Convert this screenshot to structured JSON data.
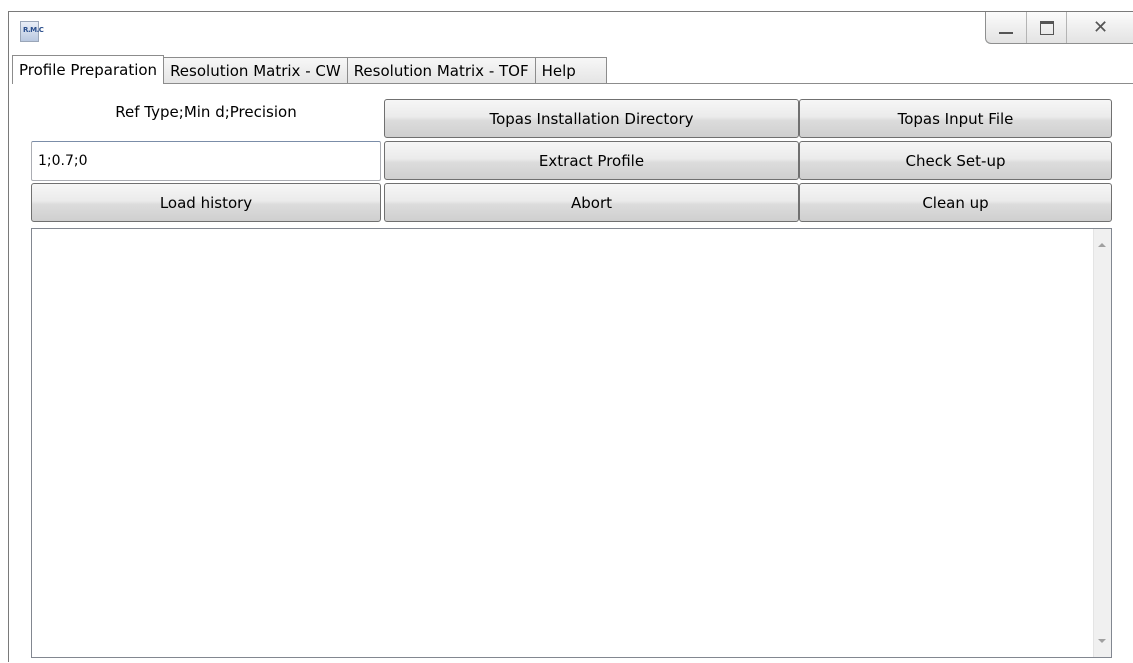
{
  "window": {
    "app_icon_text": "R.M.C",
    "controls": {
      "minimize": "minimize",
      "maximize": "maximize",
      "close": "close"
    }
  },
  "tabs": [
    {
      "label": "Profile Preparation",
      "active": true
    },
    {
      "label": "Resolution Matrix - CW",
      "active": false
    },
    {
      "label": "Resolution Matrix - TOF",
      "active": false
    },
    {
      "label": "Help",
      "active": false
    }
  ],
  "form": {
    "ref_label": "Ref Type;Min d;Precision",
    "ref_value": "1;0.7;0",
    "topas_dir_button": "Topas Installation Directory",
    "topas_input_button": "Topas Input File",
    "extract_button": "Extract Profile",
    "check_button": "Check Set-up",
    "load_history_button": "Load history",
    "abort_button": "Abort",
    "clean_up_button": "Clean up"
  },
  "output": {
    "text": ""
  }
}
